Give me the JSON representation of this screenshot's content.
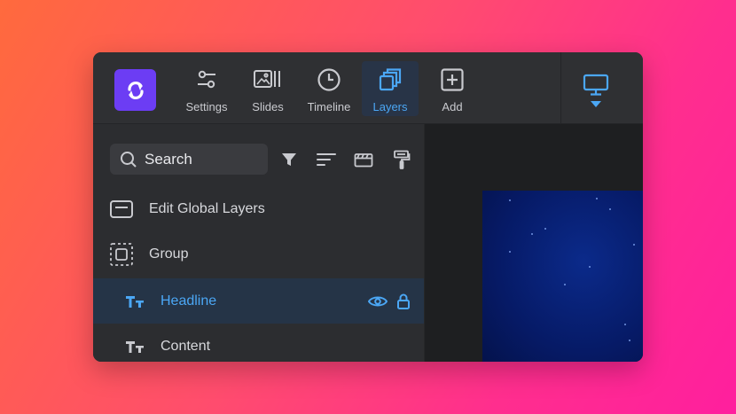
{
  "toolbar": {
    "tools": [
      {
        "id": "settings",
        "label": "Settings",
        "icon": "sliders-icon",
        "active": false
      },
      {
        "id": "slides",
        "label": "Slides",
        "icon": "slides-icon",
        "active": false
      },
      {
        "id": "timeline",
        "label": "Timeline",
        "icon": "clock-icon",
        "active": false
      },
      {
        "id": "layers",
        "label": "Layers",
        "icon": "layers-icon",
        "active": true
      },
      {
        "id": "add",
        "label": "Add",
        "icon": "plus-square-icon",
        "active": false
      }
    ],
    "device_icon": "desktop-icon"
  },
  "panel": {
    "search": {
      "label": "Search",
      "icon": "search-icon"
    },
    "filter_icons": [
      "filter-icon",
      "sort-icon",
      "clapperboard-icon",
      "paint-roller-icon"
    ],
    "layers": [
      {
        "label": "Edit Global Layers",
        "icon": "global-layers-icon",
        "selected": false
      },
      {
        "label": "Group",
        "icon": "group-icon",
        "selected": false
      },
      {
        "label": "Headline",
        "icon": "text-icon",
        "selected": true
      },
      {
        "label": "Content",
        "icon": "text-icon",
        "selected": false
      }
    ]
  },
  "colors": {
    "accent": "#4ba7f5",
    "logo": "#6c3df4",
    "window_bg": "#2c2d30",
    "selected_row": "#253447"
  }
}
